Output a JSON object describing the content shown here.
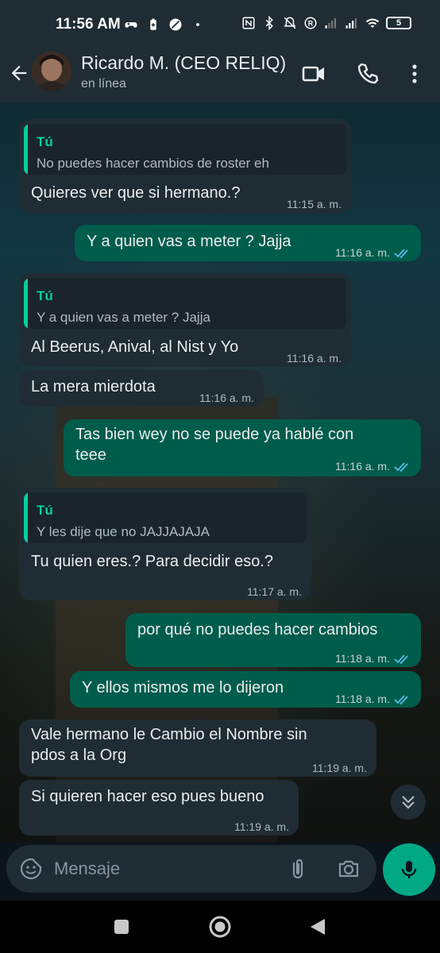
{
  "status_bar": {
    "time": "11:56 AM",
    "battery": "5",
    "icons": [
      "gamepad-icon",
      "battery-saver-icon",
      "no-disturb-icon",
      "dot-icon",
      "nfc-icon",
      "bluetooth-icon",
      "silent-icon",
      "r-icon",
      "signal-icon",
      "signal-icon",
      "wifi-icon",
      "battery-icon"
    ]
  },
  "header": {
    "contact_name": "Ricardo M. (CEO RELIQ)",
    "status": "en línea",
    "icons": [
      "back-arrow-icon",
      "video-call-icon",
      "phone-icon",
      "more-vert-icon"
    ]
  },
  "messages": [
    {
      "dir": "in",
      "quote_author": "Tú",
      "quote_text": "No puedes hacer cambios de roster eh",
      "text": "Quieres ver que si hermano.?",
      "time": "11:15 a. m."
    },
    {
      "dir": "out",
      "text": "Y a quien vas a meter ? Jajja",
      "time": "11:16 a. m.",
      "status": "read"
    },
    {
      "dir": "in",
      "quote_author": "Tú",
      "quote_text": "Y a quien vas a meter ? Jajja",
      "text": "Al Beerus, Anival, al Nist y Yo",
      "time": "11:16 a. m."
    },
    {
      "dir": "in",
      "text": "La mera mierdota",
      "time": "11:16 a. m."
    },
    {
      "dir": "out",
      "text_lines": [
        "Tas bien wey no se puede ya hablé con",
        "teee"
      ],
      "time": "11:16 a. m.",
      "status": "read"
    },
    {
      "dir": "in",
      "quote_author": "Tú",
      "quote_text": "Y les dije que no JAJJAJAJA",
      "text": "Tu quien eres.? Para decidir  eso.?",
      "time": "11:17 a. m."
    },
    {
      "dir": "out",
      "text": "por qué no puedes hacer cambios",
      "time": "11:18 a. m.",
      "status": "read"
    },
    {
      "dir": "out",
      "text": "Y ellos mismos me lo dijeron",
      "time": "11:18 a. m.",
      "status": "read"
    },
    {
      "dir": "in",
      "text_lines": [
        "Vale hermano le Cambio el Nombre sin",
        "pdos a la Org"
      ],
      "time": "11:19 a. m."
    },
    {
      "dir": "in",
      "text": "Si quieren hacer eso pues bueno",
      "time": "11:19 a. m."
    }
  ],
  "input": {
    "placeholder": "Mensaje",
    "icons": [
      "sticker-icon",
      "attach-icon",
      "camera-icon",
      "mic-icon"
    ]
  },
  "colors": {
    "incoming_bubble": "#202c33",
    "outgoing_bubble": "#005c4b",
    "accent": "#00a884",
    "quote_accent": "#06cf9c",
    "read_ticks": "#53bdeb"
  },
  "nav": {
    "icons": [
      "recents-square-icon",
      "home-circle-icon",
      "back-triangle-icon"
    ]
  }
}
